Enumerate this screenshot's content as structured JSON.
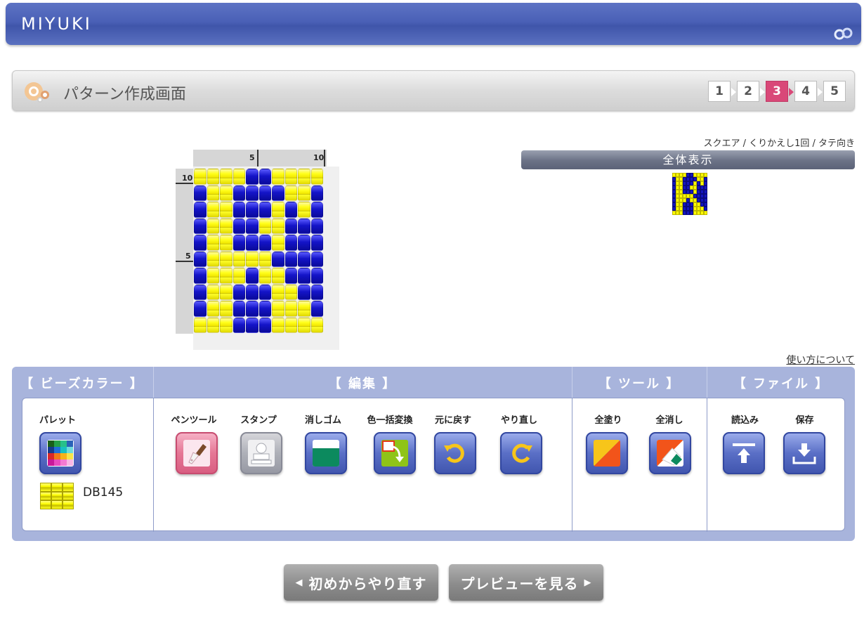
{
  "header": {
    "brand": "MIYUKI",
    "brand_icon": "link-rings-icon",
    "accent": "#4a60b6"
  },
  "title": {
    "text": "パターン作成画面",
    "icon": "beads-icon",
    "steps": [
      {
        "label": "1",
        "active": false
      },
      {
        "label": "2",
        "active": false
      },
      {
        "label": "3",
        "active": true
      },
      {
        "label": "4",
        "active": false
      },
      {
        "label": "5",
        "active": false
      }
    ],
    "active_color": "#d94878"
  },
  "grid": {
    "ruler_top": [
      "5",
      "10"
    ],
    "ruler_left": [
      "10",
      "5"
    ],
    "rows": [
      "yyyybbyyyy",
      "byybbbbyyb",
      "byybbbybyb",
      "byybbyybbb",
      "byybbbybbb",
      "byyyyybbbb",
      "byyybyybbb",
      "byybbbyybb",
      "byybbbyyyb",
      "yyybbbyyyy"
    ],
    "colors": {
      "y": "#ffff00",
      "b": "#1515c0"
    }
  },
  "preview": {
    "pattern_info": "スクエア / くりかえし1回 / タテ向き",
    "full_view_label": "全体表示"
  },
  "howto_link": "使い方について",
  "toolbar": {
    "sections": {
      "beads": "【 ビーズカラー 】",
      "edit": "【 編集 】",
      "tools": "【 ツール 】",
      "file": "【 ファイル 】"
    },
    "palette": {
      "label": "パレット",
      "icon": "palette-grid-icon",
      "selected_code": "DB145",
      "selected_color": "#ffff00"
    },
    "edit_tools": [
      {
        "label": "ペンツール",
        "icon": "pen-icon"
      },
      {
        "label": "スタンプ",
        "icon": "stamp-icon"
      },
      {
        "label": "消しゴム",
        "icon": "eraser-icon"
      },
      {
        "label": "色一括変換",
        "icon": "color-replace-icon"
      },
      {
        "label": "元に戻す",
        "icon": "undo-icon"
      },
      {
        "label": "やり直し",
        "icon": "redo-icon"
      }
    ],
    "tools": [
      {
        "label": "全塗り",
        "icon": "fill-all-icon"
      },
      {
        "label": "全消し",
        "icon": "clear-all-icon"
      }
    ],
    "file": [
      {
        "label": "読込み",
        "icon": "upload-icon"
      },
      {
        "label": "保存",
        "icon": "download-icon"
      }
    ]
  },
  "nav": {
    "restart": "初めからやり直す",
    "preview": "プレビューを見る"
  }
}
